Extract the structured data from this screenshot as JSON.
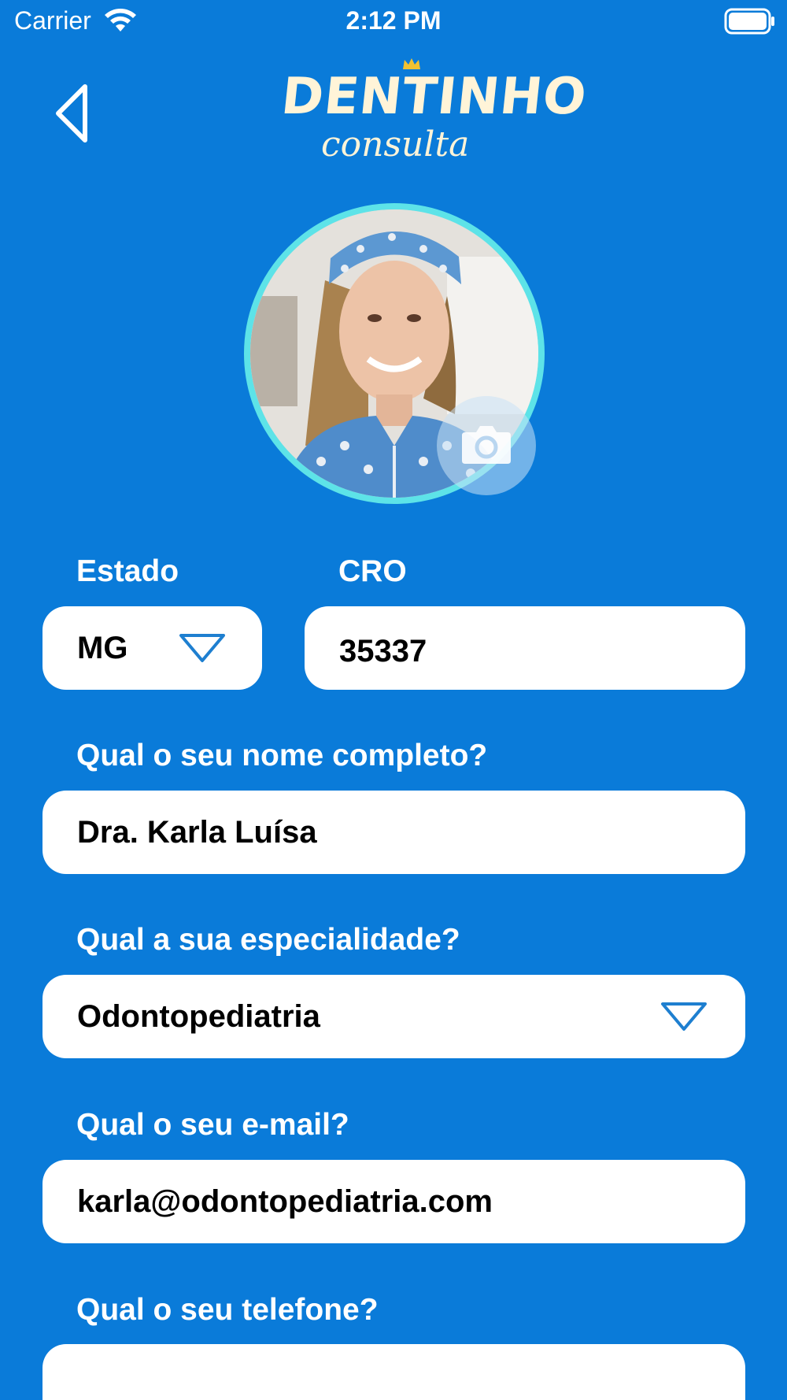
{
  "status_bar": {
    "carrier": "Carrier",
    "time": "2:12 PM"
  },
  "header": {
    "logo_title": "DENTINHO",
    "logo_subtitle": "consulta"
  },
  "form": {
    "estado_label": "Estado",
    "estado_value": "MG",
    "cro_label": "CRO",
    "cro_value": "35337",
    "nome_label": "Qual o seu nome completo?",
    "nome_value": "Dra. Karla Luísa",
    "especialidade_label": "Qual a sua especialidade?",
    "especialidade_value": "Odontopediatria",
    "email_label": "Qual o seu e-mail?",
    "email_value": "karla@odontopediatria.com",
    "telefone_label": "Qual o seu telefone?",
    "telefone_value": ""
  },
  "colors": {
    "background": "#0A7BD9",
    "avatar_ring": "#5DE3E8",
    "field_background": "#FFFFFF",
    "chevron": "#1E7FD0",
    "logo": "#FFF4D8",
    "logo_crown": "#F2C230"
  },
  "icons": {
    "back": "back-chevron-icon",
    "camera": "camera-icon",
    "dropdown": "triangle-down-icon",
    "wifi": "wifi-icon",
    "battery": "battery-icon"
  }
}
